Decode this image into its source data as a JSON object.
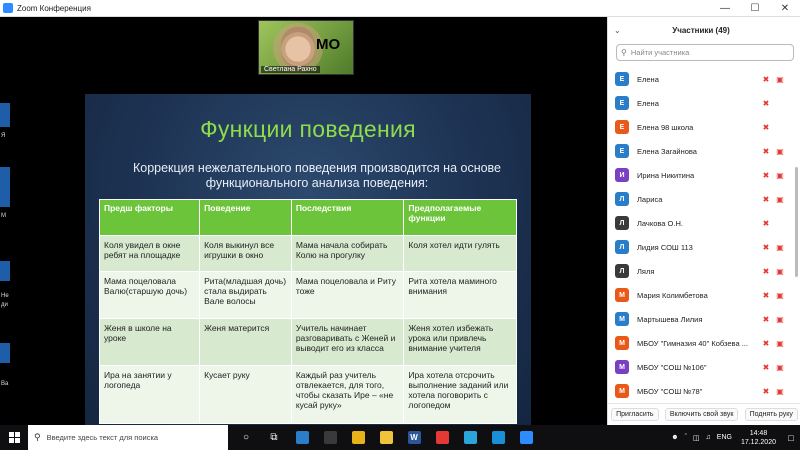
{
  "window": {
    "title": "Zoom Конференция",
    "minimize": "—",
    "maximize": "☐",
    "close": "✕"
  },
  "left_strip": {
    "labels": [
      "Я",
      "М",
      "Не",
      "ди",
      "Ва"
    ]
  },
  "video": {
    "name": "Светлана Рахно",
    "badge": "МО"
  },
  "slide": {
    "title": "Функции поведения",
    "subtitle": "Коррекция нежелательного поведения производится на основе функционального анализа поведения:",
    "headers": [
      "Предш факторы",
      "Поведение",
      "Последствия",
      "Предполагаемые функции"
    ],
    "rows": [
      [
        "Коля увидел в окне ребят на площадке",
        "Коля выкинул все игрушки в окно",
        "Мама начала собирать Колю на прогулку",
        "Коля хотел идти гулять"
      ],
      [
        "Мама поцеловала Валю(старшую дочь)",
        "Рита(младшая дочь) стала выдирать Вале волосы",
        "Мама поцеловала и Риту тоже",
        "Рита хотела маминого внимания"
      ],
      [
        "Женя в школе на уроке",
        "Женя матерится",
        "Учитель начинает разговаривать с Женей и выводит его из класса",
        "Женя хотел избежать урока или привлечь внимание учителя"
      ],
      [
        "Ира на занятии у логопеда",
        "Кусает руку",
        "Каждый раз учитель отвлекается, для того, чтобы сказать Ире – «не кусай руку»",
        "Ира хотела отсрочить выполнение заданий или хотела поговорить с логопедом"
      ]
    ]
  },
  "participants": {
    "title": "Участники (49)",
    "chevron": "⌄",
    "search_placeholder": "Найти участника",
    "items": [
      {
        "initial": "Е",
        "name": "Елена",
        "color": "#2a7dc9",
        "camoff": true
      },
      {
        "initial": "Е",
        "name": "Елена",
        "color": "#2a7dc9",
        "camoff": false
      },
      {
        "initial": "Е",
        "name": "Елена 98 школа",
        "color": "#e8591a",
        "camoff": false
      },
      {
        "initial": "Е",
        "name": "Елена Загайнова",
        "color": "#2a7dc9",
        "camoff": true
      },
      {
        "initial": "И",
        "name": "Ирина Никитина",
        "color": "#7b3fc4",
        "camoff": true
      },
      {
        "initial": "Л",
        "name": "Лариса",
        "color": "#2a7dc9",
        "camoff": true
      },
      {
        "initial": "Л",
        "name": "Лачкова О.Н.",
        "color": "#3a3a3a",
        "camoff": false
      },
      {
        "initial": "Л",
        "name": "Лидия СОШ 113",
        "color": "#2a7dc9",
        "camoff": true
      },
      {
        "initial": "Л",
        "name": "Ляля",
        "color": "#3a3a3a",
        "camoff": true
      },
      {
        "initial": "М",
        "name": "Мария Колимбетова",
        "color": "#e8591a",
        "camoff": true
      },
      {
        "initial": "М",
        "name": "Мартышева Лилия",
        "color": "#2a7dc9",
        "camoff": true
      },
      {
        "initial": "М",
        "name": "МБОУ \"Гимназия 40\" Кобзева ...",
        "color": "#e8591a",
        "camoff": true
      },
      {
        "initial": "М",
        "name": "МБОУ \"СОШ №106\"",
        "color": "#7b3fc4",
        "camoff": true
      },
      {
        "initial": "М",
        "name": "МБОУ \"СОШ №78\"",
        "color": "#e8591a",
        "camoff": true
      }
    ],
    "footer": {
      "invite": "Пригласить",
      "unmute_all": "Включить свой звук",
      "raise_hand": "Поднять руку"
    }
  },
  "taskbar": {
    "search_placeholder": "Введите здесь текст для поиска",
    "lang": "ENG",
    "time": "14:48",
    "date": "17.12.2020",
    "apps": [
      {
        "name": "cortana-icon",
        "glyph": "○",
        "color": ""
      },
      {
        "name": "task-view-icon",
        "glyph": "⧉",
        "color": ""
      },
      {
        "name": "photos-app-icon",
        "glyph": "",
        "color": "#2a7dc9"
      },
      {
        "name": "edge-legacy-icon",
        "glyph": "",
        "color": "#3a3a3a"
      },
      {
        "name": "chrome-icon",
        "glyph": "",
        "color": "#e8b31a"
      },
      {
        "name": "file-explorer-icon",
        "glyph": "",
        "color": "#f0c43a"
      },
      {
        "name": "word-icon",
        "glyph": "W",
        "color": "#2b579a"
      },
      {
        "name": "yandex-icon",
        "glyph": "",
        "color": "#e53935"
      },
      {
        "name": "paint-icon",
        "glyph": "",
        "color": "#2ba5d9"
      },
      {
        "name": "edge-icon",
        "glyph": "",
        "color": "#1a8fd9"
      },
      {
        "name": "zoom-app-icon",
        "glyph": "",
        "color": "#2d8cff"
      }
    ]
  }
}
